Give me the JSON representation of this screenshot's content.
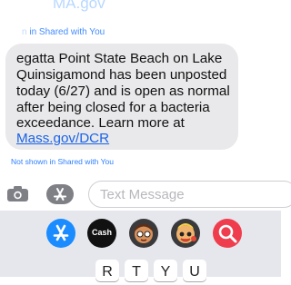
{
  "header": {
    "link_text": "MA.gov"
  },
  "message": {
    "shown_note_fade": "n",
    "shown_note": "in Shared with You",
    "lines": [
      "egatta Point State Beach on Lake",
      "Quinsigamond has been unposted",
      "today (6/27) and is open as normal",
      "after being closed for a bacteria",
      "exceedance. Learn more at"
    ],
    "link": "Mass.gov/DCR",
    "not_shown_note": "Not shown in Shared with You"
  },
  "composer": {
    "camera_icon": "camera-icon",
    "apps_icon": "app-store-icon",
    "placeholder": "Text Message"
  },
  "app_drawer": {
    "items": [
      {
        "name": "App Store",
        "icon": "app-store-icon"
      },
      {
        "name": "Cash",
        "icon": "apple-cash-icon",
        "label": "Cash"
      },
      {
        "name": "Memoji",
        "icon": "memoji-icon"
      },
      {
        "name": "Memoji Stickers",
        "icon": "memoji-sticker-icon"
      },
      {
        "name": "Search Images",
        "icon": "image-search-icon"
      }
    ]
  },
  "keyboard": {
    "row1_visible": [
      "R",
      "T",
      "Y",
      "U"
    ]
  },
  "colors": {
    "bubble": "#e9e9eb",
    "link": "#1a63e8",
    "accent_blue": "#2f80ff"
  }
}
